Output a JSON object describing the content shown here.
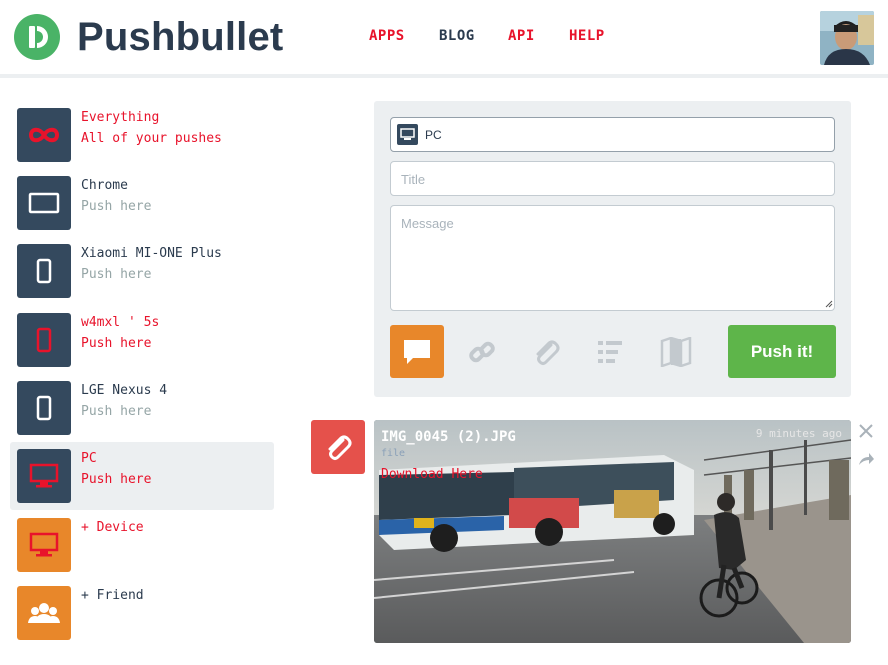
{
  "brand": "Pushbullet",
  "nav": {
    "apps": "APPS",
    "blog": "BLOG",
    "api": "API",
    "help": "HELP"
  },
  "sidebar": {
    "items": [
      {
        "title": "Everything",
        "sub": "All of your pushes",
        "icon": "infinity-icon"
      },
      {
        "title": "Chrome",
        "sub": "Push here",
        "icon": "browser-icon"
      },
      {
        "title": "Xiaomi MI-ONE Plus",
        "sub": "Push here",
        "icon": "phone-icon"
      },
      {
        "title": "w4mxl ' 5s",
        "sub": "Push here",
        "icon": "phone-icon"
      },
      {
        "title": "LGE Nexus 4",
        "sub": "Push here",
        "icon": "phone-icon"
      },
      {
        "title": "PC",
        "sub": "Push here",
        "icon": "monitor-icon"
      },
      {
        "title": "+ Device",
        "sub": "",
        "icon": "monitor-icon"
      },
      {
        "title": "+ Friend",
        "sub": "",
        "icon": "people-icon"
      }
    ]
  },
  "compose": {
    "target": "PC",
    "title_placeholder": "Title",
    "message_placeholder": "Message",
    "push_label": "Push it!"
  },
  "push": {
    "filename": "IMG_0045 (2).JPG",
    "time": "9 minutes ago",
    "link": "Download Here",
    "host": "file"
  },
  "colors": {
    "accent_red": "#e8132b",
    "navy": "#34495e",
    "orange": "#e8872a",
    "green": "#5eb54a"
  }
}
